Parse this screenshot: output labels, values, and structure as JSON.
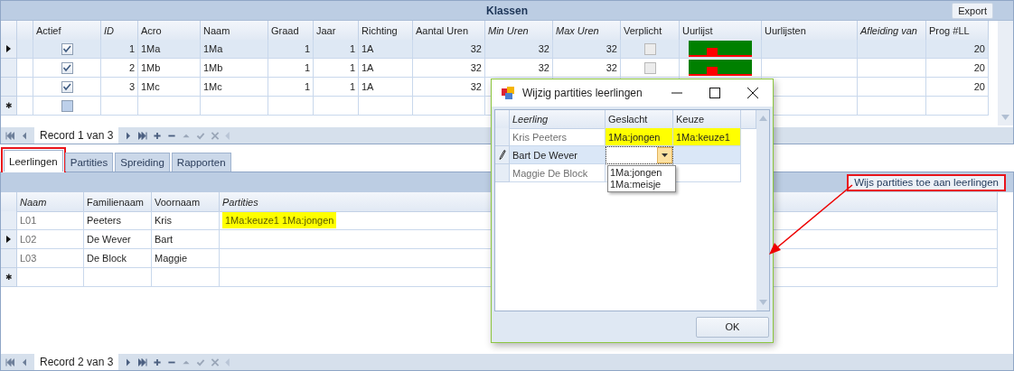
{
  "classes_grid": {
    "title": "Klassen",
    "export_button": "Export",
    "columns": [
      {
        "label": "Actief",
        "kind": "check",
        "italic": false
      },
      {
        "label": "ID",
        "kind": "number",
        "italic": true
      },
      {
        "label": "Acro",
        "kind": "text",
        "italic": false
      },
      {
        "label": "Naam",
        "kind": "text",
        "italic": false
      },
      {
        "label": "Graad",
        "kind": "number",
        "italic": false
      },
      {
        "label": "Jaar",
        "kind": "number",
        "italic": false
      },
      {
        "label": "Richting",
        "kind": "text",
        "italic": false
      },
      {
        "label": "Aantal Uren",
        "kind": "number",
        "italic": false
      },
      {
        "label": "Min Uren",
        "kind": "number",
        "italic": true
      },
      {
        "label": "Max Uren",
        "kind": "number",
        "italic": true
      },
      {
        "label": "Verplicht",
        "kind": "check_readonly",
        "italic": false
      },
      {
        "label": "Uurlijst",
        "kind": "bar",
        "italic": false
      },
      {
        "label": "Uurlijsten",
        "kind": "text",
        "italic": false
      },
      {
        "label": "Afleiding van",
        "kind": "text",
        "italic": true
      },
      {
        "label": "Prog #LL",
        "kind": "number",
        "italic": false
      }
    ],
    "rows": [
      {
        "current": true,
        "cells": [
          true,
          "1",
          "1Ma",
          "1Ma",
          "1",
          "1",
          "1A",
          "32",
          "32",
          "32",
          false,
          true,
          null,
          null,
          "20"
        ]
      },
      {
        "current": false,
        "cells": [
          true,
          "2",
          "1Mb",
          "1Mb",
          "1",
          "1",
          "1A",
          "32",
          "32",
          "32",
          false,
          true,
          null,
          null,
          "20"
        ]
      },
      {
        "current": false,
        "cells": [
          true,
          "3",
          "1Mc",
          "1Mc",
          "1",
          "1",
          "1A",
          "32",
          null,
          null,
          null,
          null,
          null,
          null,
          "20"
        ]
      }
    ],
    "new_row": {
      "marker": "✱",
      "actief": false
    },
    "navigator": "Record 1 van 3"
  },
  "tabs": [
    {
      "label": "Leerlingen",
      "selected": true,
      "annotated": true
    },
    {
      "label": "Partities",
      "selected": false,
      "annotated": false
    },
    {
      "label": "Spreiding",
      "selected": false,
      "annotated": false
    },
    {
      "label": "Rapporten",
      "selected": false,
      "annotated": false
    }
  ],
  "students_grid": {
    "assign_button": {
      "label": "Wijs partities toe aan leerlingen",
      "annotated": true
    },
    "columns": [
      {
        "label": "Naam",
        "italic": true
      },
      {
        "label": "Familienaam",
        "italic": false
      },
      {
        "label": "Voornaam",
        "italic": false
      },
      {
        "label": "Partities",
        "italic": true
      }
    ],
    "rows": [
      {
        "current": false,
        "cells": [
          "L01",
          "Peeters",
          "Kris",
          {
            "text": "1Ma:keuze1 1Ma:jongen",
            "highlighted": true
          }
        ]
      },
      {
        "current": true,
        "cells": [
          "L02",
          "De Wever",
          "Bart",
          null
        ]
      },
      {
        "current": false,
        "cells": [
          "L03",
          "De Block",
          "Maggie",
          null
        ]
      }
    ],
    "new_row_marker": "✱",
    "navigator": "Record 2 van 3"
  },
  "dialog": {
    "title": "Wijzig partities leerlingen",
    "columns": [
      {
        "label": "Leerling",
        "italic": true
      },
      {
        "label": "Geslacht",
        "italic": false
      },
      {
        "label": "Keuze",
        "italic": false
      }
    ],
    "rows": [
      {
        "editing": false,
        "leerling": "Kris Peeters",
        "geslacht": {
          "text": "1Ma:jongen",
          "highlighted": true
        },
        "keuze": {
          "text": "1Ma:keuze1",
          "highlighted": true
        }
      },
      {
        "editing": true,
        "leerling": "Bart De Wever",
        "geslacht": null,
        "keuze": null
      },
      {
        "editing": false,
        "leerling": "Maggie De Block",
        "geslacht": null,
        "keuze": null
      }
    ],
    "dropdown_options": [
      "1Ma:jongen",
      "1Ma:meisje"
    ],
    "ok_button": "OK"
  },
  "annotation_arrow": true
}
